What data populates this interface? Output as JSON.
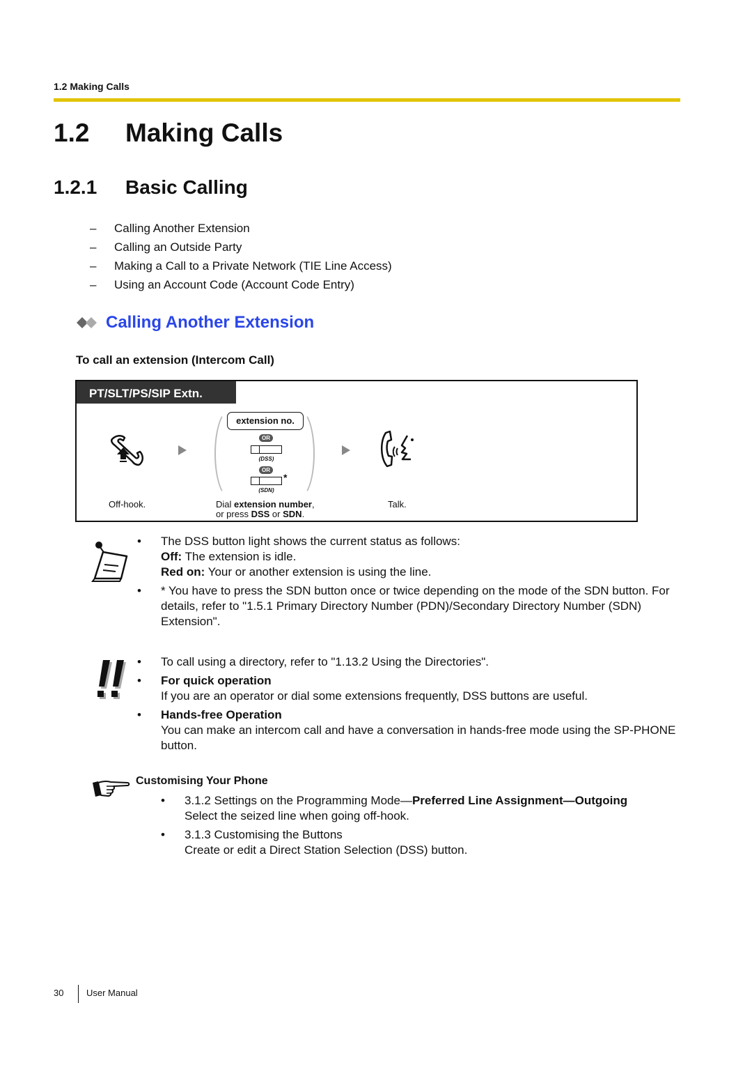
{
  "running_header": "1.2 Making Calls",
  "section": {
    "number": "1.2",
    "title": "Making Calls"
  },
  "subsection": {
    "number": "1.2.1",
    "title": "Basic Calling"
  },
  "toc_items": [
    "Calling Another Extension",
    "Calling an Outside Party",
    "Making a Call to a Private Network (TIE Line Access)",
    "Using an Account Code (Account Code Entry)"
  ],
  "topic_title": "Calling Another Extension",
  "procedure_heading": "To call an extension (Intercom Call)",
  "procedure": {
    "tab_label": "PT/SLT/PS/SIP Extn.",
    "extension_key": "extension no.",
    "or_label": "OR",
    "dss_label": "(DSS)",
    "sdn_label": "(SDN)",
    "asterisk": "*",
    "steps": {
      "offhook": "Off-hook.",
      "dial_prefix": "Dial ",
      "dial_bold": "extension number",
      "dial_comma": ",",
      "dial_line2_a": "or press ",
      "dial_line2_b": "DSS",
      "dial_line2_c": " or ",
      "dial_line2_d": "SDN",
      "dial_line2_e": ".",
      "talk": "Talk."
    }
  },
  "notes": {
    "dss_status": "The DSS button light shows the current status as follows:",
    "off_label": "Off:",
    "off_text": " The extension is idle.",
    "red_label": "Red on:",
    "red_text": " Your or another extension is using the line.",
    "sdn_note": "* You have to press the SDN button once or twice depending on the mode of the SDN button. For details, refer to \"1.5.1 Primary Directory Number (PDN)/Secondary Directory Number (SDN) Extension\"."
  },
  "tips": {
    "directory": "To call using a directory, refer to \"1.13.2 Using the Directories\".",
    "quick_title": "For quick operation",
    "quick_text": "If you are an operator or dial some extensions frequently, DSS buttons are useful.",
    "handsfree_title": "Hands-free Operation",
    "handsfree_text": "You can make an intercom call and have a conversation in hands-free mode using the SP-PHONE button."
  },
  "customising": {
    "title": "Customising Your Phone",
    "items": [
      {
        "prefix": "3.1.2 Settings on the Programming Mode—",
        "bold": "Preferred Line Assignment—Outgoing",
        "desc": "Select the seized line when going off-hook."
      },
      {
        "prefix": "3.1.3 Customising the Buttons",
        "bold": "",
        "desc": "Create or edit a Direct Station Selection (DSS) button."
      }
    ]
  },
  "footer": {
    "page_number": "30",
    "label": "User Manual"
  }
}
